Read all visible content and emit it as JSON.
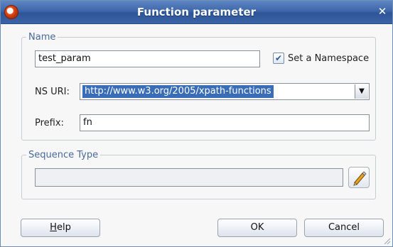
{
  "window": {
    "title": "Function parameter",
    "close_glyph": "✕"
  },
  "name_group": {
    "legend": "Name",
    "name_value": "test_param",
    "namespace_checkbox": {
      "label": "Set a Namespace",
      "checked": true,
      "glyph": "✔"
    },
    "ns_uri": {
      "label": "NS URI:",
      "value": "http://www.w3.org/2005/xpath-functions",
      "arrow": "▼"
    },
    "prefix": {
      "label": "Prefix:",
      "value": "fn"
    }
  },
  "sequence_group": {
    "legend": "Sequence Type",
    "value": ""
  },
  "buttons": {
    "help_mnemonic": "H",
    "help_rest": "elp",
    "ok": "OK",
    "cancel": "Cancel"
  },
  "colors": {
    "titlebar": "#3e67aa",
    "selection": "#3a6db7",
    "legend": "#4a6a98"
  }
}
